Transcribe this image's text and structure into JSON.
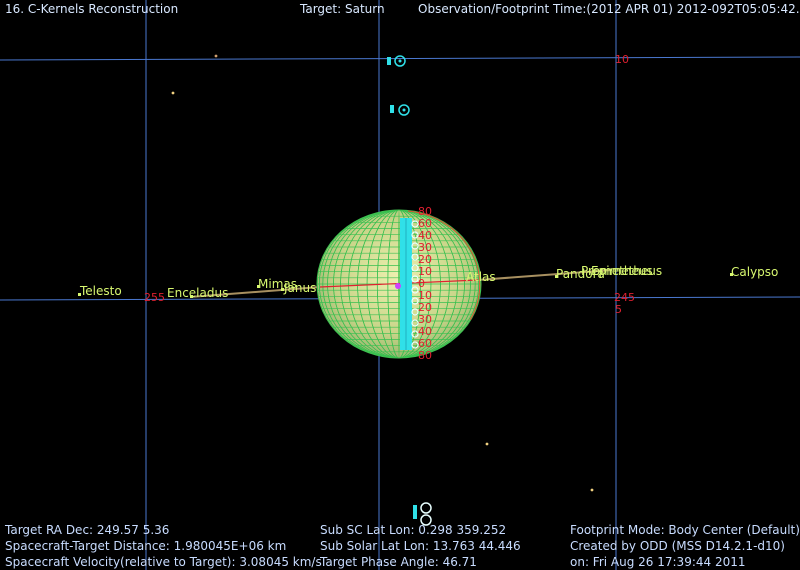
{
  "header": {
    "title": "16. C-Kernels Reconstruction",
    "target": "Target: Saturn",
    "obs_time": "Observation/Footprint Time:(2012 APR 01) 2012-092T05:05:42.00"
  },
  "grid_labels": {
    "ra_255": "255",
    "ra_245": "245",
    "dec_5": "5",
    "dec_10": "10"
  },
  "moons": {
    "telesto": "Telesto",
    "enceladus": "Enceladus",
    "mimas": "Mimas",
    "pandora": "Pandora",
    "epimetheus": "Epimetheus",
    "prometheus": "Prometheus",
    "calypso": "Calypso",
    "atlas": "Atlas",
    "janus": "Janus"
  },
  "info": {
    "left": [
      "Target RA Dec: 249.57   5.36",
      "Spacecraft-Target Distance: 1.980045E+06 km",
      "Spacecraft Velocity(relative to Target): 3.08045 km/s"
    ],
    "middle": [
      "Sub SC Lat Lon:  0.298  359.252",
      "Sub Solar Lat Lon: 13.763  44.446",
      "Target Phase Angle: 46.71"
    ],
    "right": [
      "Footprint Mode: Body Center (Default)",
      "Created by ODD (MSS D14.2.1-d10)",
      "on: Fri Aug 26 17:39:44 2011"
    ]
  },
  "colors": {
    "background": "#000000",
    "grid": "#4a78d0",
    "planet_fill": "#d6dc90",
    "planet_mesh": "#38c050",
    "footprint": "#30e0e8",
    "latlon_labels": "#e02030",
    "moon_labels": "#d8f870",
    "ring_line": "#a89060"
  }
}
